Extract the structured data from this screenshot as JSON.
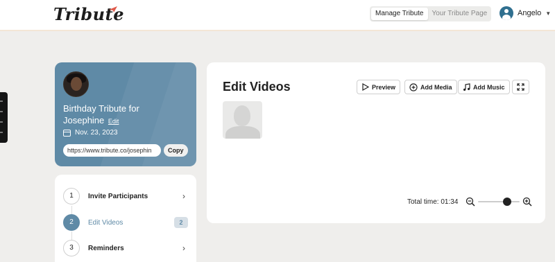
{
  "header": {
    "logo_text": "Tribute",
    "toggle": [
      "Manage Tribute",
      "Your Tribute Page"
    ],
    "user_name": "Angelo",
    "brand_color": "#5f8aa6"
  },
  "tribute": {
    "title_line1": "Birthday Tribute for",
    "title_line2": "Josephine",
    "edit_label": "Edit",
    "date": "Nov. 23, 2023",
    "url": "https://www.tribute.co/josephin",
    "copy_label": "Copy"
  },
  "steps": [
    {
      "num": "1",
      "label": "Invite Participants",
      "active": false
    },
    {
      "num": "2",
      "label": "Edit Videos",
      "active": true,
      "badge": "2"
    },
    {
      "num": "3",
      "label": "Reminders",
      "active": false
    }
  ],
  "editor": {
    "title": "Edit Videos",
    "preview_label": "Preview",
    "add_media_label": "Add Media",
    "add_music_label": "Add Music",
    "total_time_label": "Total time:",
    "total_time_value": "01:34",
    "zoom_level": 0.75
  }
}
